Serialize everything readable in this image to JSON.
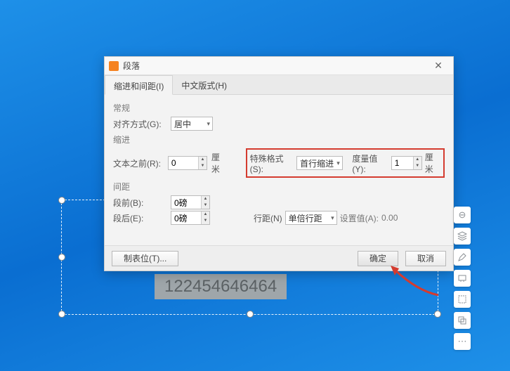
{
  "dialog": {
    "title": "段落",
    "tabs": [
      {
        "label": "缩进和间距(I)"
      },
      {
        "label": "中文版式(H)"
      }
    ],
    "sections": {
      "general": "常规",
      "indent": "缩进",
      "spacing": "间距"
    },
    "alignment": {
      "label": "对齐方式(G):",
      "value": "居中"
    },
    "textBefore": {
      "label": "文本之前(R):",
      "value": "0",
      "unit": "厘米"
    },
    "special": {
      "label": "特殊格式(S):",
      "value": "首行缩进"
    },
    "measure": {
      "label": "度量值(Y):",
      "value": "1",
      "unit": "厘米"
    },
    "spaceBefore": {
      "label": "段前(B):",
      "value": "0磅"
    },
    "spaceAfter": {
      "label": "段后(E):",
      "value": "0磅"
    },
    "lineSpacing": {
      "label": "行距(N)",
      "value": "单倍行距"
    },
    "setValue": {
      "label": "设置值(A):",
      "value": "0.00"
    },
    "buttons": {
      "tabStops": "制表位(T)...",
      "ok": "确定",
      "cancel": "取消"
    }
  },
  "canvas": {
    "text": "122454646464"
  }
}
